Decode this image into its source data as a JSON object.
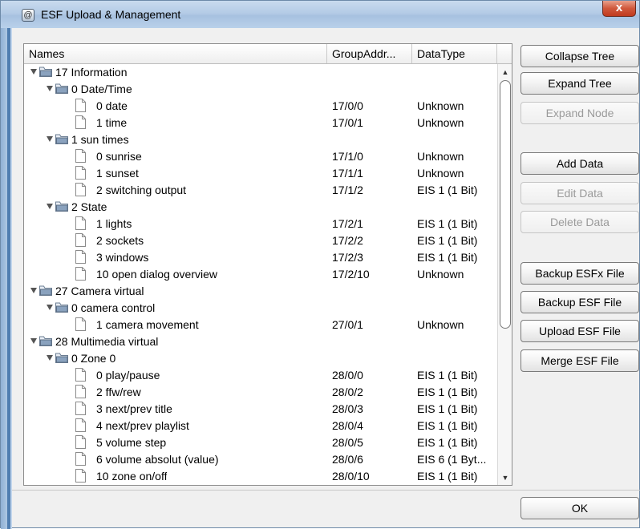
{
  "window": {
    "title": "ESF Upload & Management",
    "title_icon": "app-icon",
    "close_glyph": "x"
  },
  "table": {
    "columns": [
      "Names",
      "GroupAddr...",
      "DataType",
      ""
    ],
    "rows": [
      {
        "level": 0,
        "type": "group",
        "name": "17 Information",
        "addr": "",
        "dtype": ""
      },
      {
        "level": 1,
        "type": "group",
        "name": "0 Date/Time",
        "addr": "",
        "dtype": ""
      },
      {
        "level": 2,
        "type": "leaf",
        "name": "0 date",
        "addr": "17/0/0",
        "dtype": "Unknown"
      },
      {
        "level": 2,
        "type": "leaf",
        "name": "1 time",
        "addr": "17/0/1",
        "dtype": "Unknown"
      },
      {
        "level": 1,
        "type": "group",
        "name": "1 sun times",
        "addr": "",
        "dtype": ""
      },
      {
        "level": 2,
        "type": "leaf",
        "name": "0 sunrise",
        "addr": "17/1/0",
        "dtype": "Unknown"
      },
      {
        "level": 2,
        "type": "leaf",
        "name": "1 sunset",
        "addr": "17/1/1",
        "dtype": "Unknown"
      },
      {
        "level": 2,
        "type": "leaf",
        "name": "2 switching output",
        "addr": "17/1/2",
        "dtype": "EIS 1 (1 Bit)"
      },
      {
        "level": 1,
        "type": "group",
        "name": "2 State",
        "addr": "",
        "dtype": ""
      },
      {
        "level": 2,
        "type": "leaf",
        "name": "1 lights",
        "addr": "17/2/1",
        "dtype": "EIS 1 (1 Bit)"
      },
      {
        "level": 2,
        "type": "leaf",
        "name": "2 sockets",
        "addr": "17/2/2",
        "dtype": "EIS 1 (1 Bit)"
      },
      {
        "level": 2,
        "type": "leaf",
        "name": "3 windows",
        "addr": "17/2/3",
        "dtype": "EIS 1 (1 Bit)"
      },
      {
        "level": 2,
        "type": "leaf",
        "name": "10 open dialog overview",
        "addr": "17/2/10",
        "dtype": "Unknown"
      },
      {
        "level": 0,
        "type": "group",
        "name": "27 Camera virtual",
        "addr": "",
        "dtype": ""
      },
      {
        "level": 1,
        "type": "group",
        "name": "0 camera control",
        "addr": "",
        "dtype": ""
      },
      {
        "level": 2,
        "type": "leaf",
        "name": "1 camera movement",
        "addr": "27/0/1",
        "dtype": "Unknown"
      },
      {
        "level": 0,
        "type": "group",
        "name": "28 Multimedia virtual",
        "addr": "",
        "dtype": ""
      },
      {
        "level": 1,
        "type": "group",
        "name": "0 Zone 0",
        "addr": "",
        "dtype": ""
      },
      {
        "level": 2,
        "type": "leaf",
        "name": "0 play/pause",
        "addr": "28/0/0",
        "dtype": "EIS 1 (1 Bit)"
      },
      {
        "level": 2,
        "type": "leaf",
        "name": "2 ffw/rew",
        "addr": "28/0/2",
        "dtype": "EIS 1 (1 Bit)"
      },
      {
        "level": 2,
        "type": "leaf",
        "name": "3 next/prev title",
        "addr": "28/0/3",
        "dtype": "EIS 1 (1 Bit)"
      },
      {
        "level": 2,
        "type": "leaf",
        "name": "4 next/prev playlist",
        "addr": "28/0/4",
        "dtype": "EIS 1 (1 Bit)"
      },
      {
        "level": 2,
        "type": "leaf",
        "name": "5 volume step",
        "addr": "28/0/5",
        "dtype": "EIS 1 (1 Bit)"
      },
      {
        "level": 2,
        "type": "leaf",
        "name": "6 volume absolut (value)",
        "addr": "28/0/6",
        "dtype": "EIS 6 (1 Byt..."
      },
      {
        "level": 2,
        "type": "leaf",
        "name": "10 zone on/off",
        "addr": "28/0/10",
        "dtype": "EIS 1 (1 Bit)"
      }
    ],
    "scroll_up_glyph": "▲",
    "scroll_down_glyph": "▼"
  },
  "buttons": {
    "collapse_tree": "Collapse Tree",
    "expand_tree": "Expand Tree",
    "expand_node": "Expand Node",
    "add_data": "Add Data",
    "edit_data": "Edit Data",
    "delete_data": "Delete Data",
    "backup_esfx": "Backup ESFx File",
    "backup_esf": "Backup ESF File",
    "upload_esf": "Upload ESF File",
    "merge_esf": "Merge ESF File",
    "ok": "OK"
  },
  "colors": {
    "titlebar": "#b4cbe6",
    "close_button": "#c9472a",
    "disabled_text": "#9a9a9a",
    "folder_icon": "#8aa2be"
  }
}
